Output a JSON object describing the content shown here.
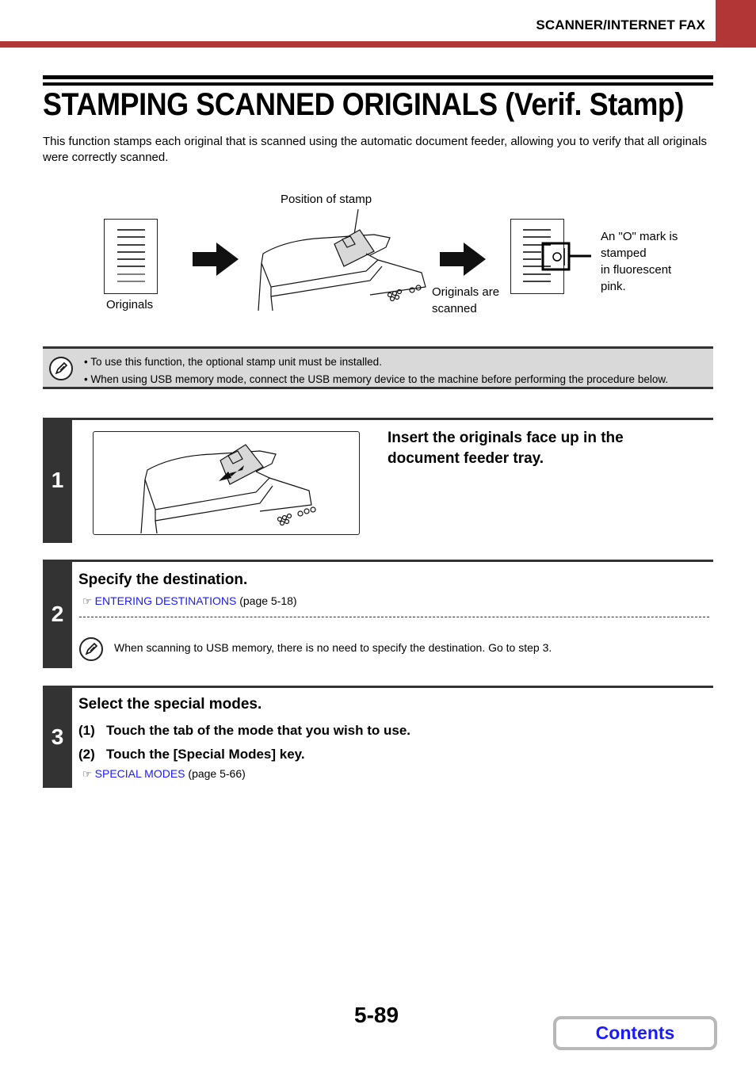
{
  "header": {
    "section": "SCANNER/INTERNET FAX",
    "accent_color": "#b33636"
  },
  "title": "STAMPING SCANNED ORIGINALS (Verif. Stamp)",
  "intro": "This function stamps each original that is scanned using the automatic document feeder, allowing you to verify that all originals were correctly scanned.",
  "diagram": {
    "originals_label": "Originals",
    "stamp_position_label": "Position of stamp",
    "scanned_label_line1": "Originals are",
    "scanned_label_line2": "scanned",
    "mark_label_lines": [
      "An \"O\" mark is",
      "stamped",
      "in fluorescent",
      "pink."
    ]
  },
  "note": {
    "icon": "pencil-icon",
    "items": [
      "To use this function, the optional stamp unit must be installed.",
      "When using USB memory mode, connect the USB memory device to the machine before performing the procedure below."
    ]
  },
  "steps": [
    {
      "number": "1",
      "heading_line1": "Insert the originals face up in the",
      "heading_line2": "document feeder tray."
    },
    {
      "number": "2",
      "heading": "Specify the destination.",
      "ref_link": "ENTERING DESTINATIONS",
      "ref_page": "(page 5-18)",
      "note": "When scanning to USB memory, there is no need to specify the destination. Go to step 3."
    },
    {
      "number": "3",
      "heading": "Select the special modes.",
      "substeps": [
        {
          "num": "(1)",
          "text": "Touch the tab of the mode that you wish to use."
        },
        {
          "num": "(2)",
          "text": "Touch the [Special Modes] key."
        }
      ],
      "ref_link": "SPECIAL MODES",
      "ref_page": "(page 5-66)"
    }
  ],
  "ref_icon": "☞",
  "footer": {
    "page_number": "5-89",
    "contents_label": "Contents",
    "link_color": "#1a1aff"
  }
}
